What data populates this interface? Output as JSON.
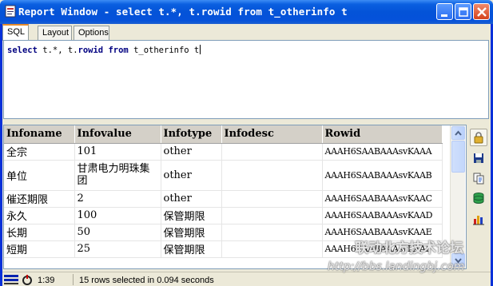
{
  "window": {
    "title": "Report Window - select t.*, t.rowid from t_otherinfo t"
  },
  "tabs": [
    {
      "label": "SQL",
      "active": true
    },
    {
      "label": "Layout",
      "active": false
    },
    {
      "label": "Options",
      "active": false
    }
  ],
  "sql": {
    "kw1": "select",
    "p1": " t.*, t.",
    "kw2": "rowid",
    "p2": " ",
    "kw3": "from",
    "p3": " t_otherinfo t"
  },
  "grid": {
    "columns": [
      "Infoname",
      "Infovalue",
      "Infotype",
      "Infodesc",
      "Rowid"
    ],
    "rows": [
      [
        "全宗",
        "101",
        "other",
        "",
        "AAAH6SAABAAAsvKAAA"
      ],
      [
        "单位",
        "甘肃电力明珠集团",
        "other",
        "",
        "AAAH6SAABAAAsvKAAB"
      ],
      [
        "催还期限",
        "2",
        "other",
        "",
        "AAAH6SAABAAAsvKAAC"
      ],
      [
        "永久",
        "100",
        "保管期限",
        "",
        "AAAH6SAABAAAsvKAAD"
      ],
      [
        "长期",
        "50",
        "保管期限",
        "",
        "AAAH6SAABAAAsvKAAE"
      ],
      [
        "短期",
        "25",
        "保管期限",
        "",
        "AAAH6SAABAAAsvKAAF"
      ]
    ]
  },
  "status": {
    "time": "1:39",
    "message": "15 rows selected in 0.094 seconds"
  },
  "watermark": {
    "line1": "联动北方技术论坛",
    "line2": "http://bbs.landingbj.com"
  },
  "colors": {
    "titlebar": "#0453d8",
    "keyword": "#000080",
    "active_tab_accent": "#e68b2c"
  },
  "icons": [
    "report-window-icon",
    "minimize-icon",
    "maximize-icon",
    "close-icon",
    "lock-icon",
    "save-icon",
    "copy-icon",
    "database-icon",
    "chart-icon"
  ]
}
